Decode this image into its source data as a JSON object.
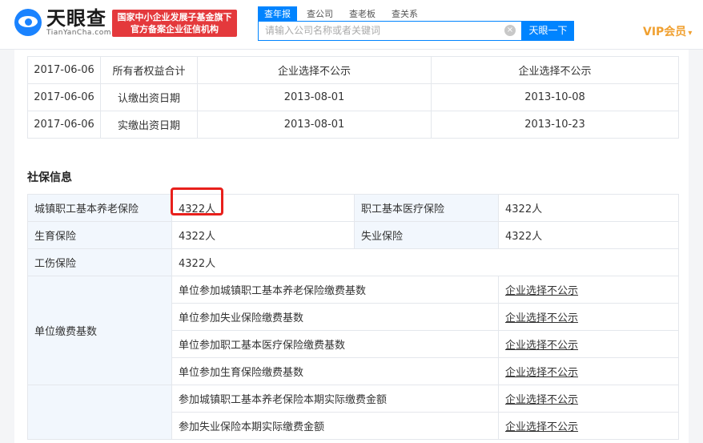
{
  "header": {
    "logo_cn": "天眼查",
    "logo_en": "TianYanCha.com",
    "badge_line1": "国家中小企业发展子基金旗下",
    "badge_line2": "官方备案企业征信机构",
    "search_tabs": [
      "查年报",
      "查公司",
      "查老板",
      "查关系"
    ],
    "search_placeholder": "请输入公司名称或者关键词",
    "clear_symbol": "×",
    "search_button": "天眼一下",
    "vip_label": "VIP会员",
    "vip_chevron": "▾"
  },
  "change_table": {
    "rows": [
      [
        "2017-06-06",
        "所有者权益合计",
        "企业选择不公示",
        "企业选择不公示"
      ],
      [
        "2017-06-06",
        "认缴出资日期",
        "2013-08-01",
        "2013-10-08"
      ],
      [
        "2017-06-06",
        "实缴出资日期",
        "2013-08-01",
        "2013-10-23"
      ]
    ]
  },
  "social_insurance": {
    "title": "社保信息",
    "pension_label": "城镇职工基本养老保险",
    "pension_value": "4322人",
    "medical_label": "职工基本医疗保险",
    "medical_value": "4322人",
    "maternity_label": "生育保险",
    "maternity_value": "4322人",
    "unemployment_label": "失业保险",
    "unemployment_value": "4322人",
    "injury_label": "工伤保险",
    "injury_value": "4322人",
    "base_label": "单位缴费基数",
    "base_items": [
      {
        "label": "单位参加城镇职工基本养老保险缴费基数",
        "value": "企业选择不公示"
      },
      {
        "label": "单位参加失业保险缴费基数",
        "value": "企业选择不公示"
      },
      {
        "label": "单位参加职工基本医疗保险缴费基数",
        "value": "企业选择不公示"
      },
      {
        "label": "单位参加生育保险缴费基数",
        "value": "企业选择不公示"
      }
    ],
    "actual_items": [
      {
        "label": "参加城镇职工基本养老保险本期实际缴费金额",
        "value": "企业选择不公示"
      },
      {
        "label": "参加失业保险本期实际缴费金额",
        "value": "企业选择不公示"
      }
    ]
  }
}
